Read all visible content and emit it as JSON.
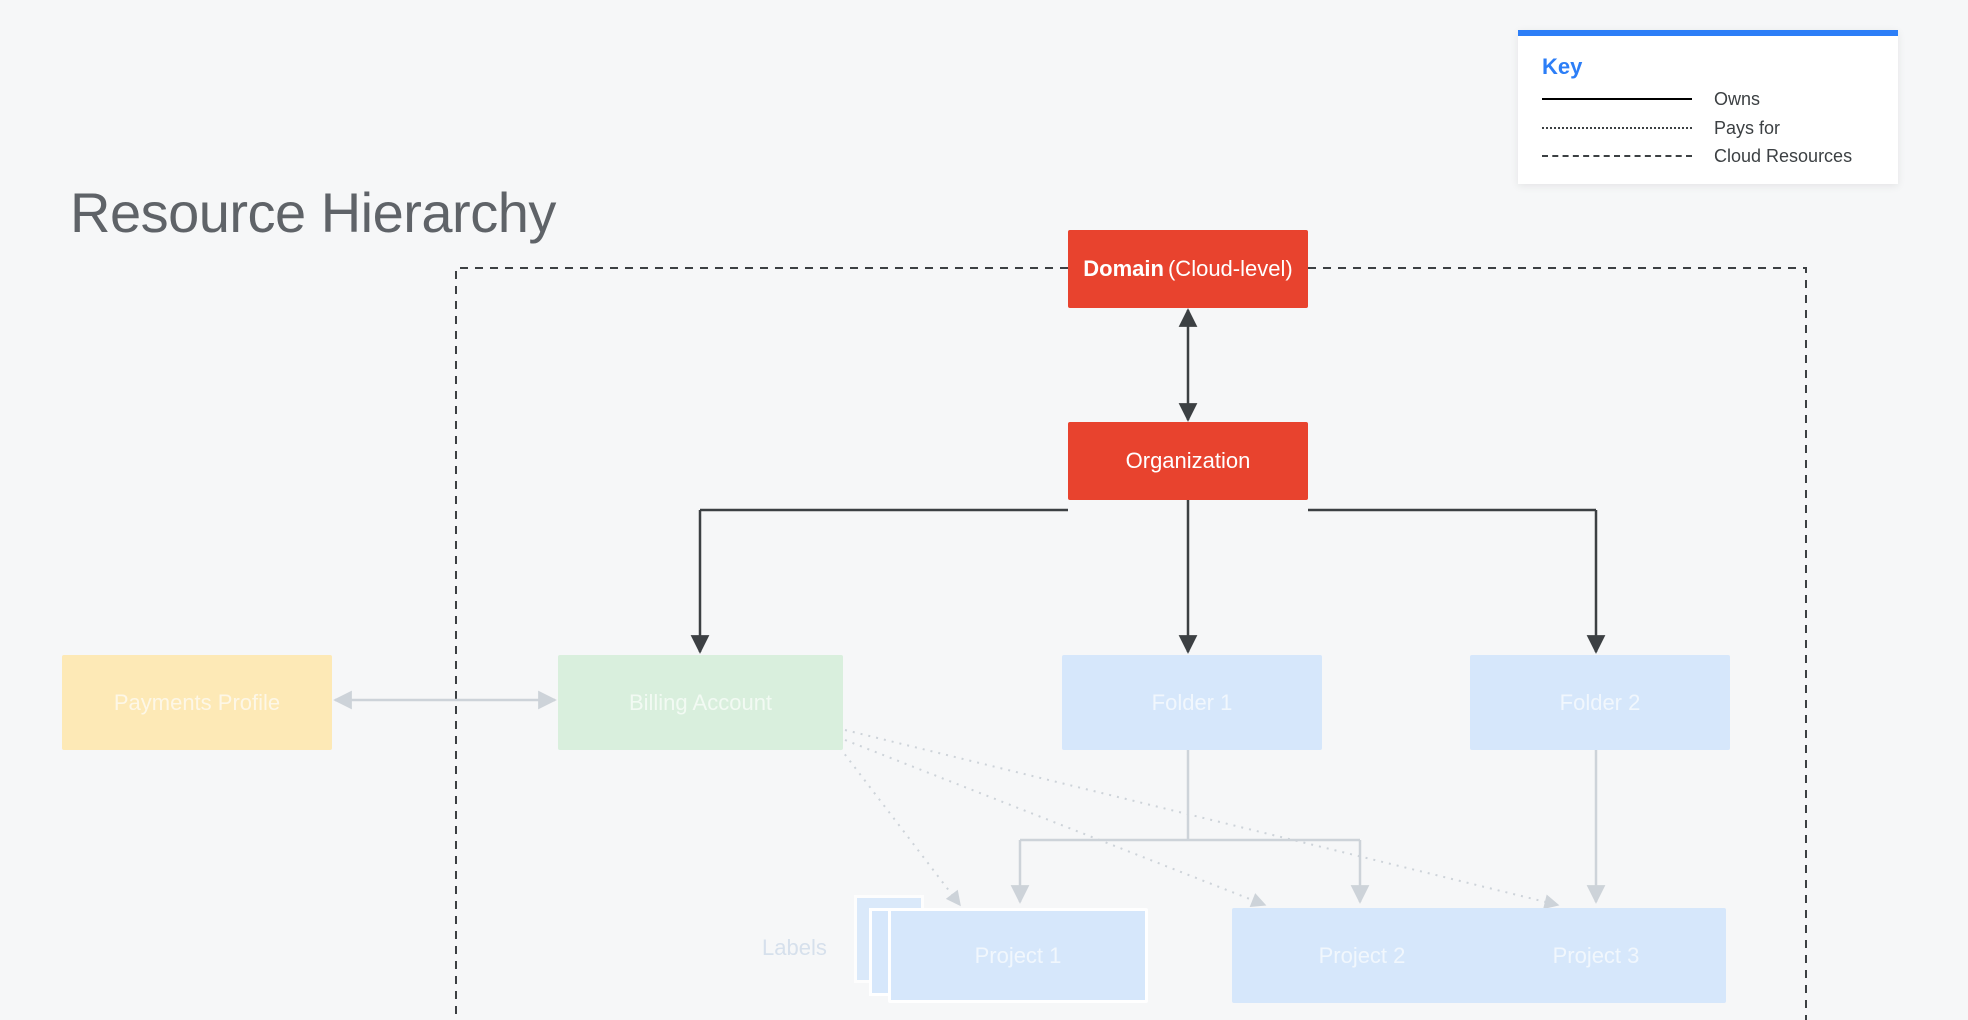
{
  "page_title": "Resource Hierarchy",
  "legend": {
    "title": "Key",
    "items": [
      {
        "style": "solid",
        "label": "Owns"
      },
      {
        "style": "dotted",
        "label": "Pays for"
      },
      {
        "style": "dashed",
        "label": "Cloud Resources"
      }
    ]
  },
  "nodes": {
    "domain": {
      "title": "Domain",
      "subtitle": "(Cloud-level)"
    },
    "organization": {
      "title": "Organization"
    },
    "payments_profile": {
      "title": "Payments Profile"
    },
    "billing_account": {
      "title": "Billing Account"
    },
    "folder1": {
      "title": "Folder 1"
    },
    "folder2": {
      "title": "Folder 2"
    },
    "project1": {
      "title": "Project 1"
    },
    "project2": {
      "title": "Project 2"
    },
    "project3": {
      "title": "Project 3"
    }
  },
  "labels_text": "Labels",
  "colors": {
    "accent_red": "#e8432e",
    "accent_blue": "#d6e7fb",
    "accent_green": "#d9efdd",
    "accent_yellow": "#fde9b6",
    "legend_blue": "#2c7ef7",
    "bg": "#f6f7f8"
  }
}
